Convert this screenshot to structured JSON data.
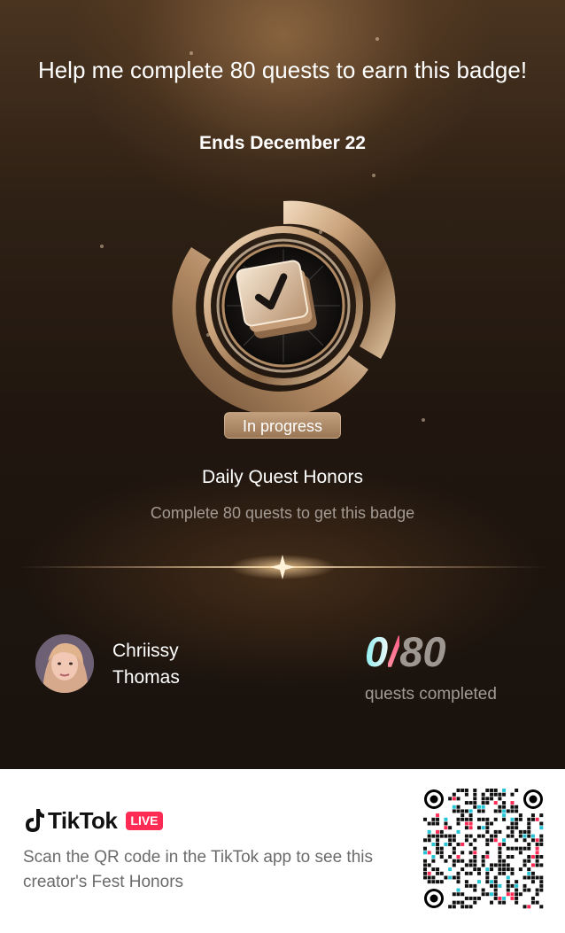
{
  "header": {
    "headline": "Help me complete 80 quests to earn this badge!",
    "ends": "Ends December 22"
  },
  "badge": {
    "icon": "checklist-card-icon",
    "status": "In progress",
    "name": "Daily Quest Honors",
    "description": "Complete 80 quests to get this badge"
  },
  "user": {
    "name": "Chriissy Thomas"
  },
  "progress": {
    "completed": "0",
    "separator": "/",
    "total": "80",
    "label": "quests completed"
  },
  "footer": {
    "brand": "TikTok",
    "live_label": "LIVE",
    "instructions": "Scan the QR code in the TikTok app to see this creator's Fest Honors",
    "qr_icon": "qr-code-icon"
  },
  "colors": {
    "accent_gold": "#c9a27a",
    "live_red": "#fe2c55",
    "count_cyan": "#8ff0f2",
    "count_pink": "#ff4f7e"
  }
}
